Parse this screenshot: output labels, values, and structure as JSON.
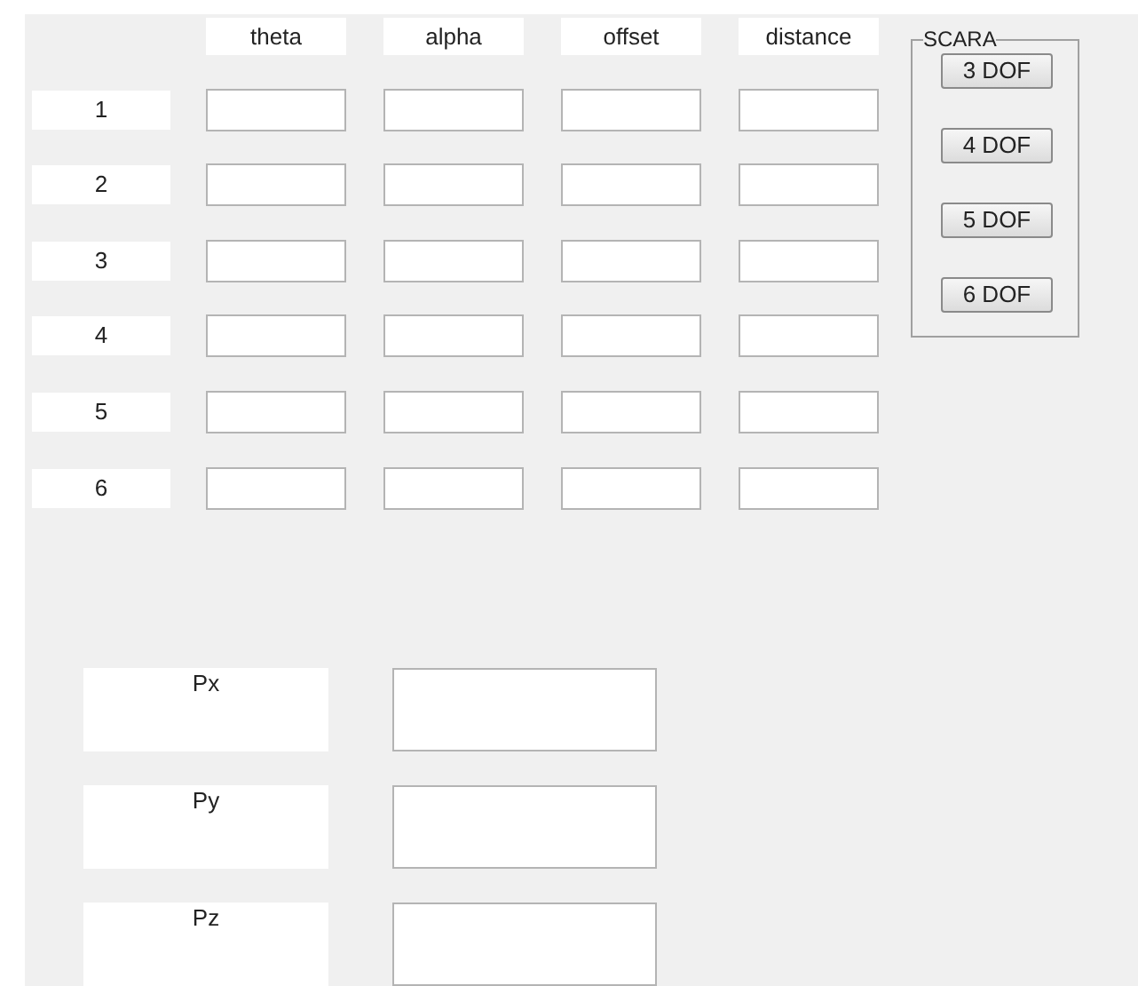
{
  "columns": [
    "theta",
    "alpha",
    "offset",
    "distance"
  ],
  "rows": [
    {
      "label": "1"
    },
    {
      "label": "2"
    },
    {
      "label": "3"
    },
    {
      "label": "4"
    },
    {
      "label": "5"
    },
    {
      "label": "6"
    }
  ],
  "scara": {
    "title": "SCARA",
    "buttons": [
      "3 DOF",
      "4 DOF",
      "5 DOF",
      "6 DOF"
    ]
  },
  "outputs": [
    {
      "label": "Px"
    },
    {
      "label": "Py"
    },
    {
      "label": "Pz"
    }
  ]
}
